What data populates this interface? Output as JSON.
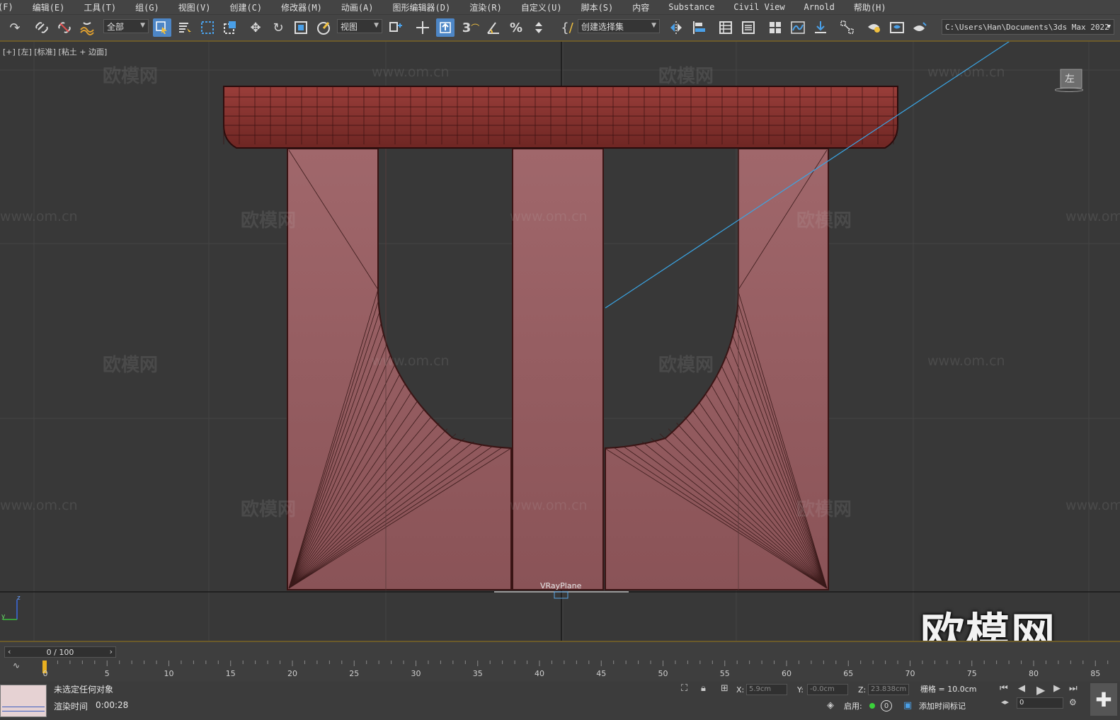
{
  "menu": [
    "(F)",
    "编辑(E)",
    "工具(T)",
    "组(G)",
    "视图(V)",
    "创建(C)",
    "修改器(M)",
    "动画(A)",
    "图形编辑器(D)",
    "渲染(R)",
    "自定义(U)",
    "脚本(S)",
    "内容",
    "Substance",
    "Civil View",
    "Arnold",
    "帮助(H)"
  ],
  "toolbar": {
    "selection_filter": "全部",
    "reference_coord": "视图",
    "named_selection_set": "创建选择集",
    "project_path": "C:\\Users\\Han\\Documents\\3ds Max 2022",
    "icons": [
      "redo-icon",
      "link-icon",
      "unlink-icon",
      "bind-spacewarp-icon",
      "select-object-icon",
      "select-by-name-icon",
      "rect-region-icon",
      "window-crossing-icon",
      "move-icon",
      "rotate-icon",
      "scale-icon",
      "placement-icon",
      "pivot-icon",
      "snap-3-icon",
      "angle-snap-icon",
      "percent-snap-icon",
      "spinner-snap-icon",
      "edit-named-sel-icon",
      "mirror-icon",
      "align-icon",
      "layer-explorer-icon",
      "toggle-ribbon-icon",
      "scene-explorer-icon",
      "curve-editor-icon",
      "schematic-icon",
      "material-editor-icon",
      "render-setup-icon",
      "rendered-frame-icon",
      "render-icon"
    ]
  },
  "viewport": {
    "label": "[+] [左] [标准] [粘土 + 边面]",
    "viewcube_label": "左",
    "object_label": "VRayPlane",
    "watermark_text": "欧模网",
    "watermark_url": "www.om.cn",
    "brand_watermark": "欧模网",
    "model_color": "#9a5a5e",
    "seat_color": "#8a3532"
  },
  "timeline": {
    "frame_counter": "0 / 100",
    "ticks": [
      "0",
      "5",
      "10",
      "15",
      "20",
      "25",
      "30",
      "35",
      "40",
      "45",
      "50",
      "55",
      "60",
      "65",
      "70",
      "75",
      "80",
      "85"
    ]
  },
  "status": {
    "selection": "未选定任何对象",
    "render_time_label": "渲染时间",
    "render_time": "0:00:28",
    "x_label": "X:",
    "x_value": "5.9cm",
    "y_label": "Y:",
    "y_value": "-0.0cm",
    "z_label": "Z:",
    "z_value": "23.838cm",
    "grid": "栅格 = 10.0cm",
    "enable_label": "启用:",
    "enable_count": "0",
    "add_time_tag": "添加时间标记",
    "frame_value": "0"
  }
}
